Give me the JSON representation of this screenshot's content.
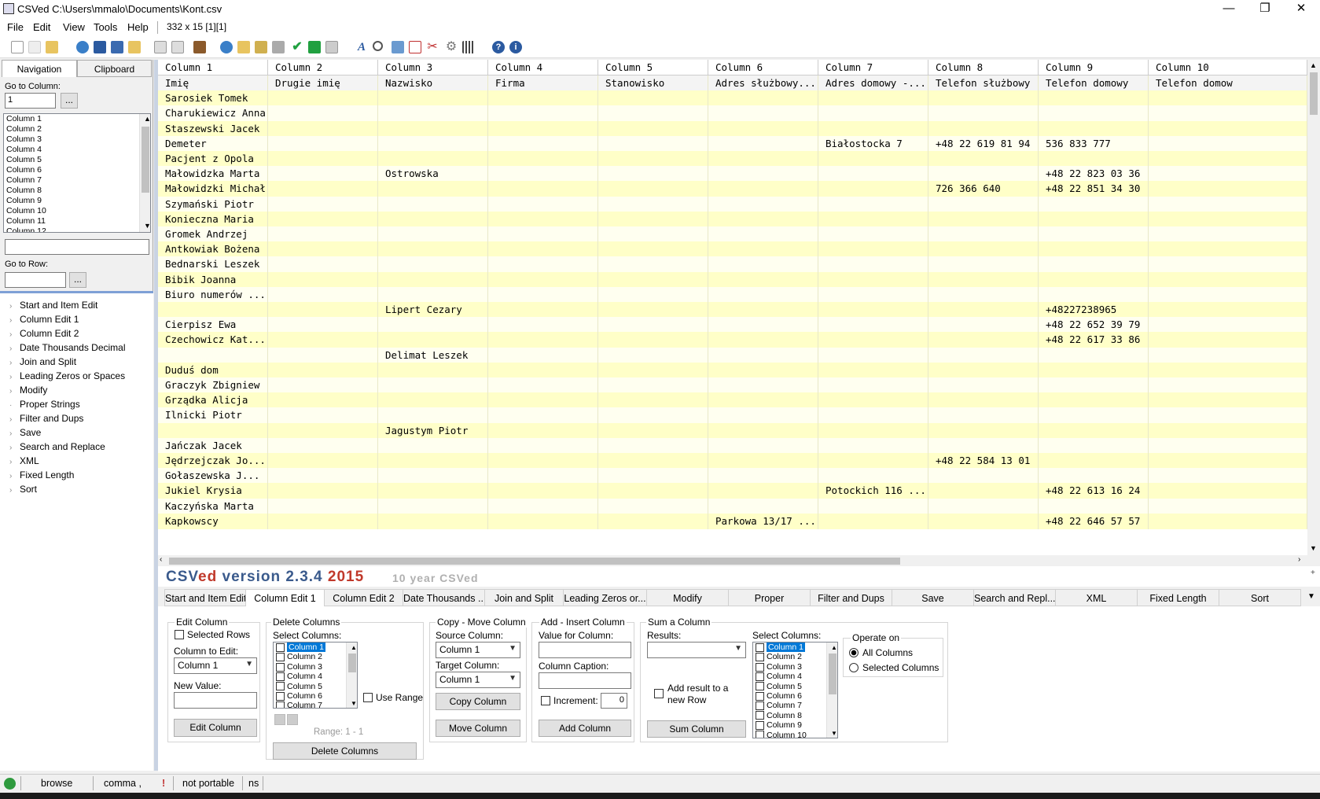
{
  "window": {
    "title": "CSVed C:\\Users\\mmalo\\Documents\\Kont.csv",
    "minimize": "—",
    "maximize": "❐",
    "close": "✕"
  },
  "menu": {
    "items": [
      "File",
      "Edit",
      "View",
      "Tools",
      "Help"
    ],
    "info": "332 x 15 [1][1]"
  },
  "left": {
    "tabs": [
      "Navigation",
      "Clipboard"
    ],
    "goto_column_label": "Go to Column:",
    "goto_column_value": "1",
    "browse_btn": "...",
    "columns": [
      "Column 1",
      "Column 2",
      "Column 3",
      "Column 4",
      "Column 5",
      "Column 6",
      "Column 7",
      "Column 8",
      "Column 9",
      "Column 10",
      "Column 11",
      "Column 12"
    ],
    "goto_row_label": "Go to Row:",
    "tree": [
      "Start and Item Edit",
      "Column Edit 1",
      "Column Edit 2",
      "Date Thousands Decimal",
      "Join and Split",
      "Leading Zeros or Spaces",
      "Modify",
      "Proper Strings",
      "Filter and Dups",
      "Save",
      "Search and Replace",
      "XML",
      "Fixed Length",
      "Sort"
    ]
  },
  "grid": {
    "headers": [
      "Column 1",
      "Column 2",
      "Column 3",
      "Column 4",
      "Column 5",
      "Column 6",
      "Column 7",
      "Column 8",
      "Column 9",
      "Column 10"
    ],
    "rows": [
      [
        "Imię",
        "Drugie imię",
        "Nazwisko",
        "Firma",
        "Stanowisko",
        "Adres służbowy...",
        "Adres domowy -...",
        "Telefon służbowy",
        "Telefon domowy",
        "Telefon domow"
      ],
      [
        "Sarosiek Tomek",
        "",
        "",
        "",
        "",
        "",
        "",
        "",
        "",
        ""
      ],
      [
        "Charukiewicz Anna",
        "",
        "",
        "",
        "",
        "",
        "",
        "",
        "",
        ""
      ],
      [
        "Staszewski  Jacek",
        "",
        "",
        "",
        "",
        "",
        "",
        "",
        "",
        ""
      ],
      [
        "Demeter",
        "",
        "",
        "",
        "",
        "",
        "Białostocka 7",
        "+48 22 619 81 94",
        "536 833 777",
        ""
      ],
      [
        "Pacjent z Opola",
        "",
        "",
        "",
        "",
        "",
        "",
        "",
        "",
        ""
      ],
      [
        "Małowidzka Marta",
        "",
        "Ostrowska",
        "",
        "",
        "",
        "",
        "",
        "+48 22 823 03 36",
        ""
      ],
      [
        "Małowidzki Michał",
        "",
        "",
        "",
        "",
        "",
        "",
        "726 366 640",
        "+48 22 851 34 30",
        ""
      ],
      [
        "Szymański Piotr",
        "",
        "",
        "",
        "",
        "",
        "",
        "",
        "",
        ""
      ],
      [
        "Konieczna Maria",
        "",
        "",
        "",
        "",
        "",
        "",
        "",
        "",
        ""
      ],
      [
        "Gromek Andrzej",
        "",
        "",
        "",
        "",
        "",
        "",
        "",
        "",
        ""
      ],
      [
        "Antkowiak Bożena",
        "",
        "",
        "",
        "",
        "",
        "",
        "",
        "",
        ""
      ],
      [
        "Bednarski Leszek",
        "",
        "",
        "",
        "",
        "",
        "",
        "",
        "",
        ""
      ],
      [
        "Bibik Joanna",
        "",
        "",
        "",
        "",
        "",
        "",
        "",
        "",
        ""
      ],
      [
        "Biuro numerów ...",
        "",
        "",
        "",
        "",
        "",
        "",
        "",
        "",
        ""
      ],
      [
        "",
        "",
        "Lipert Cezary",
        "",
        "",
        "",
        "",
        "",
        "+48227238965",
        ""
      ],
      [
        "Cierpisz Ewa",
        "",
        "",
        "",
        "",
        "",
        "",
        "",
        "+48 22 652 39 79",
        ""
      ],
      [
        "Czechowicz Kat...",
        "",
        "",
        "",
        "",
        "",
        "",
        "",
        "+48 22 617 33 86",
        ""
      ],
      [
        "",
        "",
        "Delimat Leszek",
        "",
        "",
        "",
        "",
        "",
        "",
        ""
      ],
      [
        "Duduś dom",
        "",
        "",
        "",
        "",
        "",
        "",
        "",
        "",
        ""
      ],
      [
        "Graczyk Zbigniew",
        "",
        "",
        "",
        "",
        "",
        "",
        "",
        "",
        ""
      ],
      [
        "Grządka Alicja",
        "",
        "",
        "",
        "",
        "",
        "",
        "",
        "",
        ""
      ],
      [
        "Ilnicki Piotr",
        "",
        "",
        "",
        "",
        "",
        "",
        "",
        "",
        ""
      ],
      [
        "",
        "",
        "Jagustym Piotr",
        "",
        "",
        "",
        "",
        "",
        "",
        ""
      ],
      [
        "Jańczak Jacek",
        "",
        "",
        "",
        "",
        "",
        "",
        "",
        "",
        ""
      ],
      [
        "Jędrzejczak Jo...",
        "",
        "",
        "",
        "",
        "",
        "",
        "+48 22 584 13 01",
        "",
        ""
      ],
      [
        "Gołaszewska  J...",
        "",
        "",
        "",
        "",
        "",
        "",
        "",
        "",
        ""
      ],
      [
        "Jukiel Krysia",
        "",
        "",
        "",
        "",
        "",
        "Potockich 116 ...",
        "",
        "+48 22 613 16 24",
        ""
      ],
      [
        "Kaczyńska Marta",
        "",
        "",
        "",
        "",
        "",
        "",
        "",
        "",
        ""
      ],
      [
        "Kapkowscy",
        "",
        "",
        "",
        "",
        "Parkowa 13/17 ...",
        "",
        "",
        "+48 22 646 57 57",
        ""
      ]
    ]
  },
  "banner": {
    "part1": "CSV",
    "part2": "ed",
    "part3": " version 2.3.4 ",
    "year": "2015",
    "tagline": "10 year CSVed"
  },
  "tabs": [
    "Start and Item Edit",
    "Column Edit 1",
    "Column Edit 2",
    "Date Thousands ...",
    "Join and Split",
    "Leading Zeros or...",
    "Modify",
    "Proper",
    "Filter and Dups",
    "Save",
    "Search and Repl...",
    "XML",
    "Fixed Length",
    "Sort"
  ],
  "panel": {
    "edit_column": {
      "title": "Edit Column",
      "selected_rows": "Selected Rows",
      "column_to_edit": "Column to Edit:",
      "column_value": "Column 1",
      "new_value": "New Value:",
      "button": "Edit Column"
    },
    "delete_columns": {
      "title": "Delete Columns",
      "select_columns": "Select Columns:",
      "list": [
        "Column 1",
        "Column 2",
        "Column 3",
        "Column 4",
        "Column 5",
        "Column 6",
        "Column 7"
      ],
      "use_range": "Use Range",
      "range": "Range: 1 - 1",
      "button": "Delete Columns"
    },
    "copy_move": {
      "title": "Copy - Move Column",
      "source": "Source Column:",
      "source_value": "Column 1",
      "target": "Target Column:",
      "target_value": "Column 1",
      "copy_btn": "Copy Column",
      "move_btn": "Move Column"
    },
    "add_insert": {
      "title": "Add - Insert Column",
      "value_for_column": "Value for Column:",
      "caption": "Column Caption:",
      "increment": "Increment:",
      "increment_value": "0",
      "button": "Add Column"
    },
    "sum": {
      "title": "Sum a Column",
      "results": "Results:",
      "add_result": "Add result to a new Row",
      "button": "Sum Column",
      "select_columns": "Select Columns:",
      "list": [
        "Column 1",
        "Column 2",
        "Column 3",
        "Column 4",
        "Column 5",
        "Column 6",
        "Column 7",
        "Column 8",
        "Column 9",
        "Column 10"
      ]
    },
    "operate": {
      "title": "Operate on",
      "all": "All Columns",
      "selected": "Selected Columns"
    }
  },
  "status": {
    "mode": "browse",
    "separator": "comma ,",
    "excl": "!",
    "portable": "not portable",
    "ns": "ns"
  },
  "colors": {
    "row_even": "#fffff0",
    "row_odd": "#ffffc8",
    "banner_blue": "#3a5a8c",
    "banner_red": "#c0392b",
    "banner_grey": "#b0b0b0"
  }
}
